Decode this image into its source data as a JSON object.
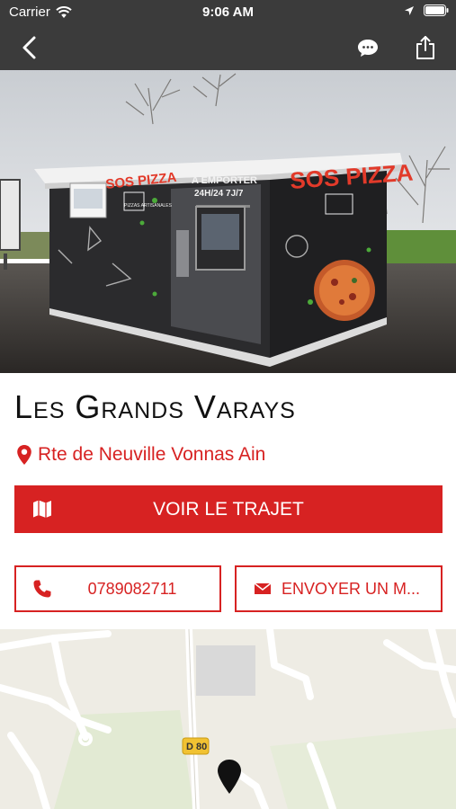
{
  "status_bar": {
    "carrier": "Carrier",
    "time": "9:06 AM"
  },
  "nav": {
    "back_icon": "chevron-left-icon",
    "chat_icon": "chat-bubble-icon",
    "share_icon": "share-icon"
  },
  "hero": {
    "kiosk_brand": "SOS PIZZA",
    "kiosk_lines": [
      "PIZZAS",
      "A EMPORTER",
      "24H/24  7J/7"
    ],
    "side_label": "PIZZAS ARTISANALES"
  },
  "place": {
    "name": "Les Grands Varays",
    "address": "Rte de Neuville Vonnas Ain"
  },
  "actions": {
    "route_label": "VOIR LE TRAJET",
    "phone": "0789082711",
    "message_label": "ENVOYER UN M..."
  },
  "map": {
    "road_label": "D 80"
  },
  "colors": {
    "accent": "#d72222",
    "topbar": "#3b3b3b",
    "map_bg": "#eeece4"
  }
}
